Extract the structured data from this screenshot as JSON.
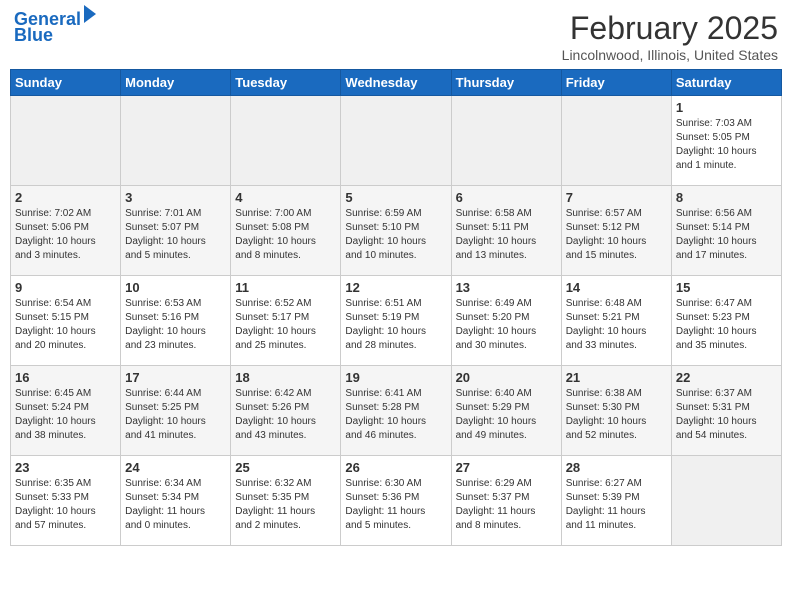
{
  "header": {
    "logo_line1": "General",
    "logo_line2": "Blue",
    "month_title": "February 2025",
    "location": "Lincolnwood, Illinois, United States"
  },
  "weekdays": [
    "Sunday",
    "Monday",
    "Tuesday",
    "Wednesday",
    "Thursday",
    "Friday",
    "Saturday"
  ],
  "weeks": [
    [
      {
        "day": "",
        "info": ""
      },
      {
        "day": "",
        "info": ""
      },
      {
        "day": "",
        "info": ""
      },
      {
        "day": "",
        "info": ""
      },
      {
        "day": "",
        "info": ""
      },
      {
        "day": "",
        "info": ""
      },
      {
        "day": "1",
        "info": "Sunrise: 7:03 AM\nSunset: 5:05 PM\nDaylight: 10 hours\nand 1 minute."
      }
    ],
    [
      {
        "day": "2",
        "info": "Sunrise: 7:02 AM\nSunset: 5:06 PM\nDaylight: 10 hours\nand 3 minutes."
      },
      {
        "day": "3",
        "info": "Sunrise: 7:01 AM\nSunset: 5:07 PM\nDaylight: 10 hours\nand 5 minutes."
      },
      {
        "day": "4",
        "info": "Sunrise: 7:00 AM\nSunset: 5:08 PM\nDaylight: 10 hours\nand 8 minutes."
      },
      {
        "day": "5",
        "info": "Sunrise: 6:59 AM\nSunset: 5:10 PM\nDaylight: 10 hours\nand 10 minutes."
      },
      {
        "day": "6",
        "info": "Sunrise: 6:58 AM\nSunset: 5:11 PM\nDaylight: 10 hours\nand 13 minutes."
      },
      {
        "day": "7",
        "info": "Sunrise: 6:57 AM\nSunset: 5:12 PM\nDaylight: 10 hours\nand 15 minutes."
      },
      {
        "day": "8",
        "info": "Sunrise: 6:56 AM\nSunset: 5:14 PM\nDaylight: 10 hours\nand 17 minutes."
      }
    ],
    [
      {
        "day": "9",
        "info": "Sunrise: 6:54 AM\nSunset: 5:15 PM\nDaylight: 10 hours\nand 20 minutes."
      },
      {
        "day": "10",
        "info": "Sunrise: 6:53 AM\nSunset: 5:16 PM\nDaylight: 10 hours\nand 23 minutes."
      },
      {
        "day": "11",
        "info": "Sunrise: 6:52 AM\nSunset: 5:17 PM\nDaylight: 10 hours\nand 25 minutes."
      },
      {
        "day": "12",
        "info": "Sunrise: 6:51 AM\nSunset: 5:19 PM\nDaylight: 10 hours\nand 28 minutes."
      },
      {
        "day": "13",
        "info": "Sunrise: 6:49 AM\nSunset: 5:20 PM\nDaylight: 10 hours\nand 30 minutes."
      },
      {
        "day": "14",
        "info": "Sunrise: 6:48 AM\nSunset: 5:21 PM\nDaylight: 10 hours\nand 33 minutes."
      },
      {
        "day": "15",
        "info": "Sunrise: 6:47 AM\nSunset: 5:23 PM\nDaylight: 10 hours\nand 35 minutes."
      }
    ],
    [
      {
        "day": "16",
        "info": "Sunrise: 6:45 AM\nSunset: 5:24 PM\nDaylight: 10 hours\nand 38 minutes."
      },
      {
        "day": "17",
        "info": "Sunrise: 6:44 AM\nSunset: 5:25 PM\nDaylight: 10 hours\nand 41 minutes."
      },
      {
        "day": "18",
        "info": "Sunrise: 6:42 AM\nSunset: 5:26 PM\nDaylight: 10 hours\nand 43 minutes."
      },
      {
        "day": "19",
        "info": "Sunrise: 6:41 AM\nSunset: 5:28 PM\nDaylight: 10 hours\nand 46 minutes."
      },
      {
        "day": "20",
        "info": "Sunrise: 6:40 AM\nSunset: 5:29 PM\nDaylight: 10 hours\nand 49 minutes."
      },
      {
        "day": "21",
        "info": "Sunrise: 6:38 AM\nSunset: 5:30 PM\nDaylight: 10 hours\nand 52 minutes."
      },
      {
        "day": "22",
        "info": "Sunrise: 6:37 AM\nSunset: 5:31 PM\nDaylight: 10 hours\nand 54 minutes."
      }
    ],
    [
      {
        "day": "23",
        "info": "Sunrise: 6:35 AM\nSunset: 5:33 PM\nDaylight: 10 hours\nand 57 minutes."
      },
      {
        "day": "24",
        "info": "Sunrise: 6:34 AM\nSunset: 5:34 PM\nDaylight: 11 hours\nand 0 minutes."
      },
      {
        "day": "25",
        "info": "Sunrise: 6:32 AM\nSunset: 5:35 PM\nDaylight: 11 hours\nand 2 minutes."
      },
      {
        "day": "26",
        "info": "Sunrise: 6:30 AM\nSunset: 5:36 PM\nDaylight: 11 hours\nand 5 minutes."
      },
      {
        "day": "27",
        "info": "Sunrise: 6:29 AM\nSunset: 5:37 PM\nDaylight: 11 hours\nand 8 minutes."
      },
      {
        "day": "28",
        "info": "Sunrise: 6:27 AM\nSunset: 5:39 PM\nDaylight: 11 hours\nand 11 minutes."
      },
      {
        "day": "",
        "info": ""
      }
    ]
  ]
}
